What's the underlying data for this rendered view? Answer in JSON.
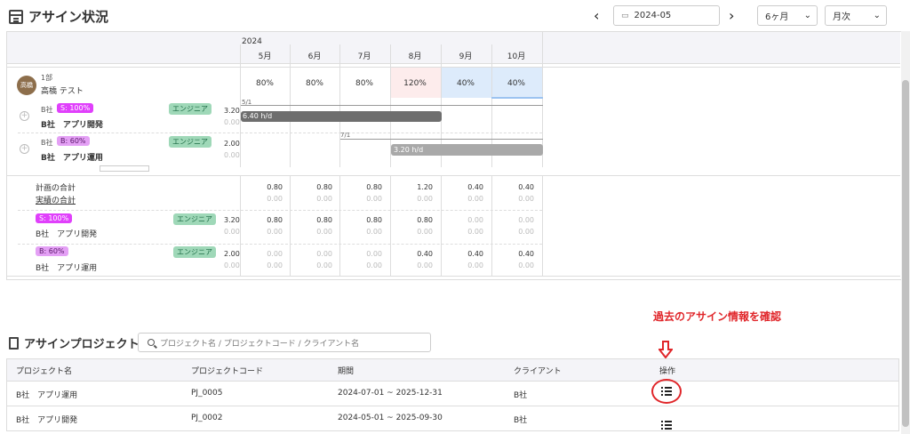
{
  "header": {
    "title": "アサイン状況",
    "date_value": "2024-05",
    "period_select": "6ヶ月",
    "unit_select": "月次"
  },
  "timeline": {
    "year": "2024",
    "months": [
      "5月",
      "6月",
      "7月",
      "8月",
      "9月",
      "10月"
    ],
    "person": {
      "avatar": "高橋",
      "dept": "1部",
      "name": "高橋 テスト",
      "rates": [
        "80%",
        "80%",
        "80%",
        "120%",
        "40%",
        "40%"
      ]
    },
    "assignments": [
      {
        "client": "B社",
        "tag": "S: 100%",
        "project": "B社　アプリ開発",
        "role": "エンジニア",
        "plan": "3.20",
        "actual": "0.00",
        "start_label": "5/1",
        "bar_label": "6.40 h/d"
      },
      {
        "client": "B社",
        "tag": "B: 60%",
        "project": "B社　アプリ運用",
        "role": "エンジニア",
        "plan": "2.00",
        "actual": "0.00",
        "start_label": "7/1",
        "bar_label": "3.20 h/d"
      }
    ]
  },
  "totals": {
    "plan_label": "計画の合計",
    "actual_label": "実績の合計",
    "plan": [
      "0.80",
      "0.80",
      "0.80",
      "1.20",
      "0.40",
      "0.40"
    ],
    "actual": [
      "0.00",
      "0.00",
      "0.00",
      "0.00",
      "0.00",
      "0.00"
    ],
    "rows": [
      {
        "tag": "S: 100%",
        "project": "B社　アプリ開発",
        "role": "エンジニア",
        "plan": "3.20",
        "actual": "0.00",
        "months_plan": [
          "0.80",
          "0.80",
          "0.80",
          "0.80",
          "0.00",
          "0.00"
        ],
        "months_actual": [
          "0.00",
          "0.00",
          "0.00",
          "0.00",
          "0.00",
          "0.00"
        ]
      },
      {
        "tag": "B: 60%",
        "project": "B社　アプリ運用",
        "role": "エンジニア",
        "plan": "2.00",
        "actual": "0.00",
        "months_plan": [
          "0.00",
          "0.00",
          "0.00",
          "0.40",
          "0.40",
          "0.40"
        ],
        "months_actual": [
          "0.00",
          "0.00",
          "0.00",
          "0.00",
          "0.00",
          "0.00"
        ]
      }
    ]
  },
  "projects": {
    "title": "アサインプロジェクト",
    "search_placeholder": "プロジェクト名 / プロジェクトコード / クライアント名",
    "columns": [
      "プロジェクト名",
      "プロジェクトコード",
      "期間",
      "クライアント",
      "操作"
    ],
    "rows": [
      {
        "name": "B社　アプリ運用",
        "code": "PJ_0005",
        "period": "2024-07-01 ~ 2025-12-31",
        "client": "B社"
      },
      {
        "name": "B社　アプリ開発",
        "code": "PJ_0002",
        "period": "2024-05-01 ~ 2025-09-30",
        "client": "B社"
      }
    ]
  },
  "annotation": {
    "text": "過去のアサイン情報を確認",
    "color": "#e0262a"
  },
  "colors": {
    "bar_dark": "#6e6e6e",
    "bar_light": "#a9a9a9",
    "over_bg": "#fdecec",
    "low_bg": "#ddebfb",
    "engineer_tag": "#9fd8b8",
    "s_tag": "#e040fb",
    "b_tag": "#e4a0f5"
  }
}
